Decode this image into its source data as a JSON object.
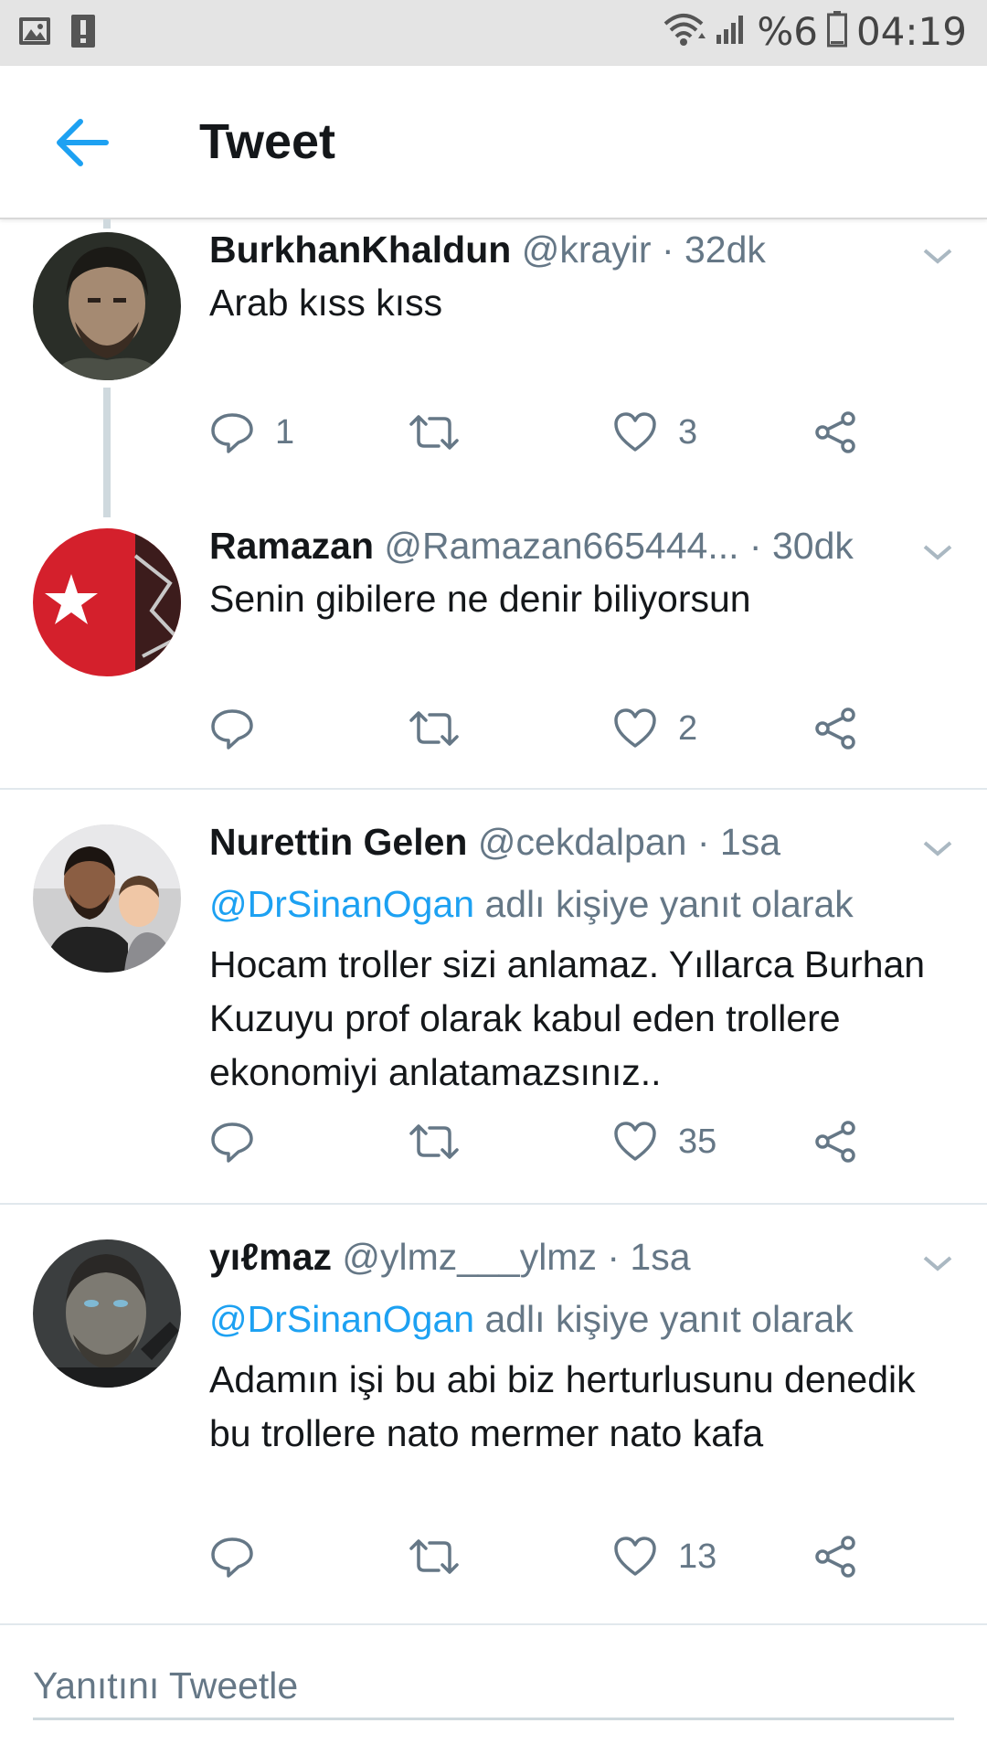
{
  "status_bar": {
    "battery_text": "%6",
    "time": "04:19"
  },
  "header": {
    "title": "Tweet"
  },
  "tweets": [
    {
      "display_name": "BurkhanKhaldun",
      "handle": "@krayir",
      "time": "· 32dk",
      "reply_mention": "",
      "reply_suffix": "",
      "text": "Arab kıss kıss",
      "reply_count": "1",
      "retweet_count": "",
      "like_count": "3"
    },
    {
      "display_name": "Ramazan",
      "handle": "@Ramazan665444...",
      "time": "· 30dk",
      "reply_mention": "",
      "reply_suffix": "",
      "text": "Senin gibilere ne denir biliyorsun",
      "reply_count": "",
      "retweet_count": "",
      "like_count": "2"
    },
    {
      "display_name": "Nurettin Gelen",
      "handle": "@cekdalpan",
      "time": "· 1sa",
      "reply_mention": "@DrSinanOgan",
      "reply_suffix": "adlı kişiye yanıt olarak",
      "text": "Hocam troller sizi anlamaz. Yıllarca Burhan Kuzuyu prof olarak kabul eden trollere ekonomiyi anlatamazsınız..",
      "reply_count": "",
      "retweet_count": "",
      "like_count": "35"
    },
    {
      "display_name": "yıℓmaz",
      "handle": "@ylmz___ylmz",
      "time": "· 1sa",
      "reply_mention": "@DrSinanOgan",
      "reply_suffix": "adlı kişiye yanıt olarak",
      "text": "Adamın işi bu abi biz herturlusunu denedik bu trollere nato mermer nato kafa",
      "reply_count": "",
      "retweet_count": "",
      "like_count": "13"
    }
  ],
  "reply_bar": {
    "placeholder": "Yanıtını Tweetle"
  },
  "colors": {
    "accent": "#1da1f2",
    "secondary_text": "#657786",
    "divider": "#e1e8ed",
    "status_bar": "#e4e4e4"
  }
}
